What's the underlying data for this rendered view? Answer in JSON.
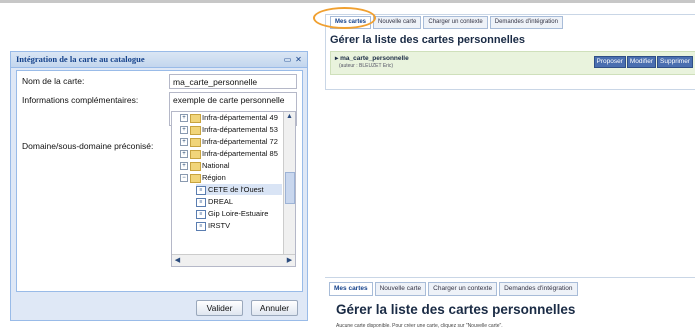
{
  "top_panel": {
    "tabs": [
      "Mes cartes",
      "Nouvelle carte",
      "Charger un contexte",
      "Demandes d'intégration"
    ],
    "title": "Gérer la liste des cartes personnelles",
    "card": {
      "name": "ma_carte_personnelle",
      "author": "(auteur : BLEUZET Eric)",
      "actions": [
        "Proposer",
        "Modifier",
        "Supprimer"
      ]
    }
  },
  "dialog": {
    "title": "Intégration de la carte au catalogue",
    "fields": {
      "name_label": "Nom de la carte:",
      "name_value": "ma_carte_personnelle",
      "info_label": "Informations complémentaires:",
      "info_value": "exemple de carte personnelle",
      "domain_label": "Domaine/sous-domaine préconisé:"
    },
    "tree": [
      {
        "label": "Infra-départemental 49",
        "type": "folder",
        "expander": "+"
      },
      {
        "label": "Infra-départemental 53",
        "type": "folder",
        "expander": "+"
      },
      {
        "label": "Infra-départemental 72",
        "type": "folder",
        "expander": "+"
      },
      {
        "label": "Infra-départemental 85",
        "type": "folder",
        "expander": "+"
      },
      {
        "label": "National",
        "type": "folder",
        "expander": "+"
      },
      {
        "label": "Région",
        "type": "folder",
        "expander": "−"
      },
      {
        "label": "CETE de l'Ouest",
        "type": "leaf",
        "selected": true
      },
      {
        "label": "DREAL",
        "type": "leaf"
      },
      {
        "label": "Gip Loire-Estuaire",
        "type": "leaf"
      },
      {
        "label": "IRSTV",
        "type": "leaf"
      }
    ],
    "buttons": {
      "validate": "Valider",
      "cancel": "Annuler"
    }
  },
  "bottom_panel": {
    "tabs": [
      "Mes cartes",
      "Nouvelle carte",
      "Charger un contexte",
      "Demandes d'intégration"
    ],
    "title": "Gérer la liste des cartes personnelles",
    "empty_message": "Aucune carte disponible. Pour créer une carte, cliquez sur \"Nouvelle carte\"."
  }
}
